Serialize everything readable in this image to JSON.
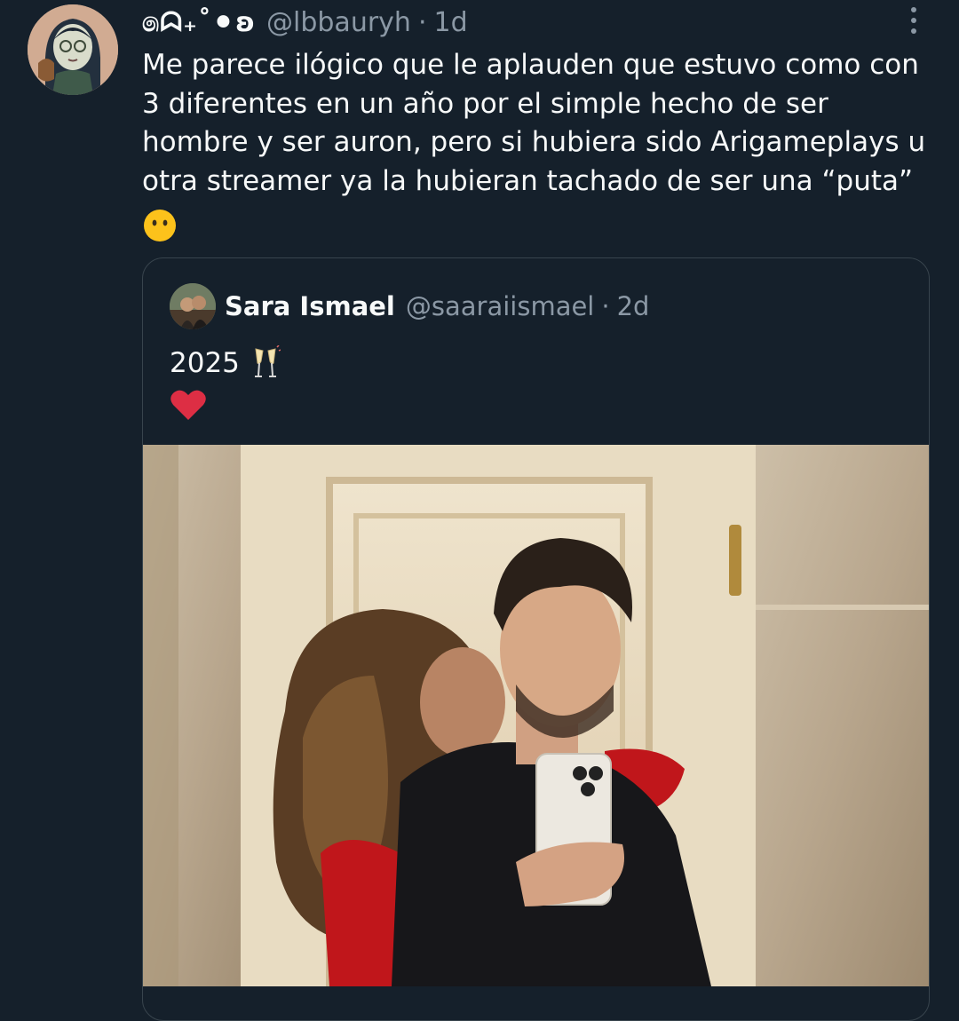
{
  "tweet": {
    "display_name": "෧ᗣ₊˚⚫ʚ",
    "handle": "@lbbauryh",
    "dot": "·",
    "time": "1d",
    "text": "Me parece ilógico que le aplauden que estuvo como con\n3 diferentes en un año por el simple hecho de ser\nhombre y ser auron, pero si hubiera sido Arigameplays u\notra streamer ya la hubieran tachado de ser una “puta”",
    "emoji": "grimacing-face-without-mouth"
  },
  "quote": {
    "display_name": "Sara Ismael",
    "handle": "@saaraiismael",
    "dot": "·",
    "time": "2d",
    "text": "2025",
    "emojis": [
      "champagne-glasses",
      "red-heart"
    ],
    "photo": "couple mirror selfie"
  },
  "colors": {
    "background": "#15202b",
    "text_primary": "#f7f9f9",
    "text_secondary": "#8b98a5",
    "border": "#38444d"
  }
}
